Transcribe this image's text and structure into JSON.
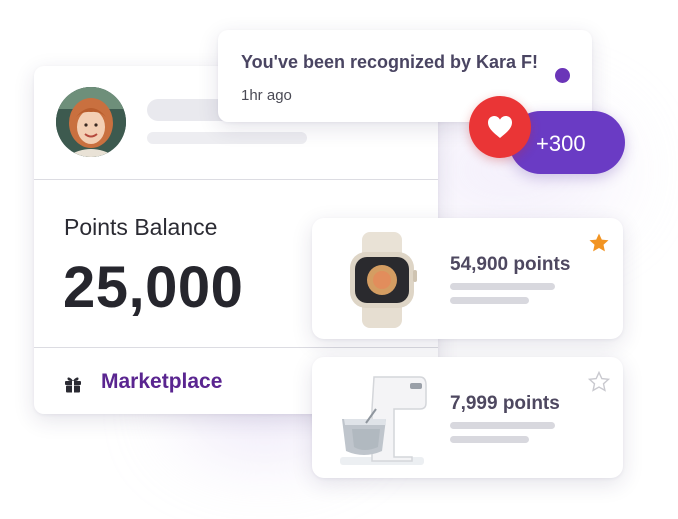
{
  "profile": {
    "avatar_icon": "user-avatar-photo"
  },
  "balance": {
    "label": "Points Balance",
    "value": "25,000"
  },
  "marketplace": {
    "icon": "gift-icon",
    "label": "Marketplace"
  },
  "notification": {
    "title": "You've been recognized by Kara F!",
    "time": "1hr ago",
    "unread_color": "#6b35b8"
  },
  "reward": {
    "points": "+300",
    "icon": "heart-icon",
    "pill_color": "#6a3bc4",
    "badge_color": "#ea3536"
  },
  "products": [
    {
      "image": "smartwatch",
      "points": "54,900 points",
      "favorite": true,
      "star_color": "#f29422"
    },
    {
      "image": "stand-mixer",
      "points": "7,999 points",
      "favorite": false,
      "star_color": "#c9c9cf"
    }
  ]
}
